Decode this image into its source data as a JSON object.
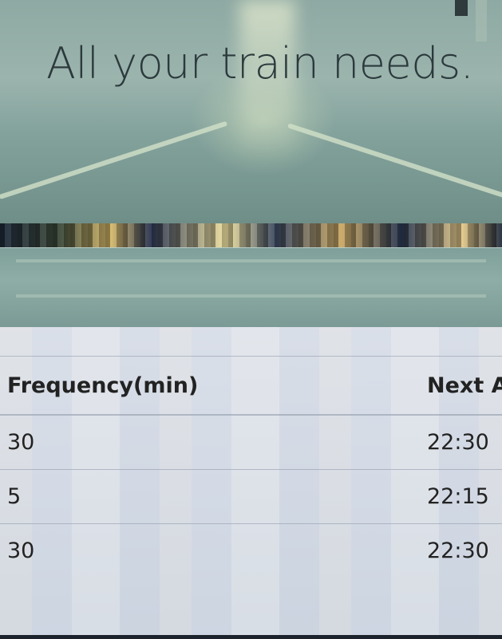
{
  "hero": {
    "title": "All your train needs."
  },
  "table": {
    "headers": [
      "Frequency(min)",
      "Next A"
    ],
    "rows": [
      [
        "30",
        "22:30"
      ],
      [
        "5",
        "22:15"
      ],
      [
        "30",
        "22:30"
      ]
    ]
  }
}
